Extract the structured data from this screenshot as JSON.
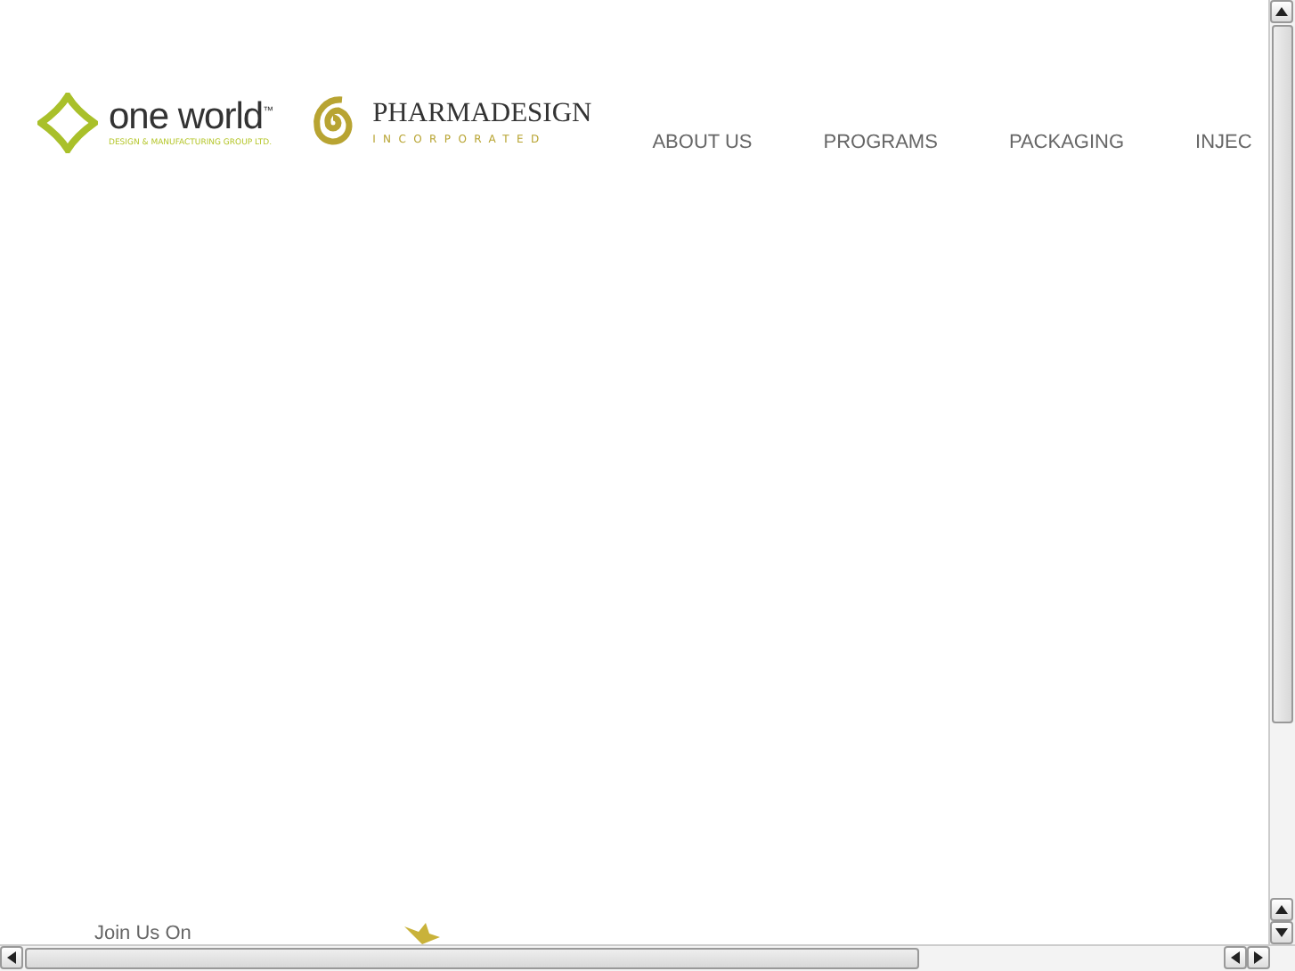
{
  "logos": {
    "one_world": {
      "name": "one world",
      "trademark": "™",
      "tagline": "DESIGN & MANUFACTURING GROUP LTD."
    },
    "pharmadesign": {
      "name": "PHARMADESIGN",
      "tagline": "INCORPORATED"
    }
  },
  "nav": [
    {
      "label": "ABOUT US"
    },
    {
      "label": "PROGRAMS"
    },
    {
      "label": "PACKAGING"
    },
    {
      "label": "INJEC"
    }
  ],
  "footer": {
    "join_label": "Join Us On"
  }
}
